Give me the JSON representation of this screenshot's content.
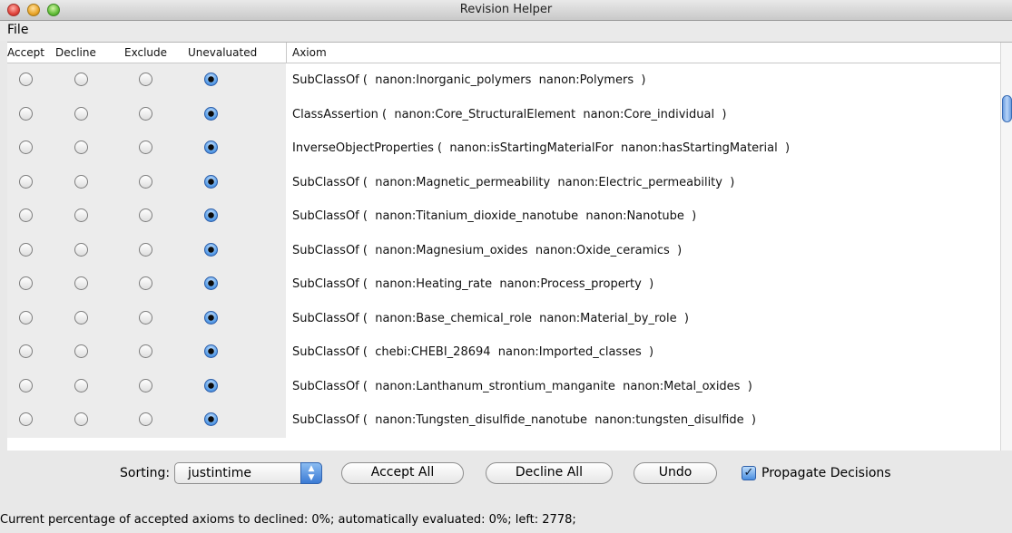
{
  "window": {
    "title": "Revision Helper"
  },
  "menu": {
    "file": "File"
  },
  "table": {
    "headers": {
      "accept": "Accept",
      "decline": "Decline",
      "exclude": "Exclude",
      "unevaluated": "Unevaluated",
      "axiom": "Axiom"
    },
    "selected_column": "unevaluated",
    "rows": [
      {
        "axiom": "SubClassOf (  nanon:Inorganic_polymers  nanon:Polymers  )"
      },
      {
        "axiom": "ClassAssertion (  nanon:Core_StructuralElement  nanon:Core_individual  )"
      },
      {
        "axiom": "InverseObjectProperties (  nanon:isStartingMaterialFor  nanon:hasStartingMaterial  )"
      },
      {
        "axiom": "SubClassOf (  nanon:Magnetic_permeability  nanon:Electric_permeability  )"
      },
      {
        "axiom": "SubClassOf (  nanon:Titanium_dioxide_nanotube  nanon:Nanotube  )"
      },
      {
        "axiom": "SubClassOf (  nanon:Magnesium_oxides  nanon:Oxide_ceramics  )"
      },
      {
        "axiom": "SubClassOf (  nanon:Heating_rate  nanon:Process_property  )"
      },
      {
        "axiom": "SubClassOf (  nanon:Base_chemical_role  nanon:Material_by_role  )"
      },
      {
        "axiom": "SubClassOf (  chebi:CHEBI_28694  nanon:Imported_classes  )"
      },
      {
        "axiom": "SubClassOf (  nanon:Lanthanum_strontium_manganite  nanon:Metal_oxides  )"
      },
      {
        "axiom": "SubClassOf (  nanon:Tungsten_disulfide_nanotube  nanon:tungsten_disulfide  )"
      }
    ]
  },
  "controls": {
    "sorting_label": "Sorting:",
    "sorting_value": "justintime",
    "accept_all": "Accept All",
    "decline_all": "Decline All",
    "undo": "Undo",
    "propagate_label": "Propagate Decisions",
    "propagate_checked": true
  },
  "status": "Current percentage of accepted axioms to declined: 0%; automatically evaluated: 0%; left: 2778;"
}
